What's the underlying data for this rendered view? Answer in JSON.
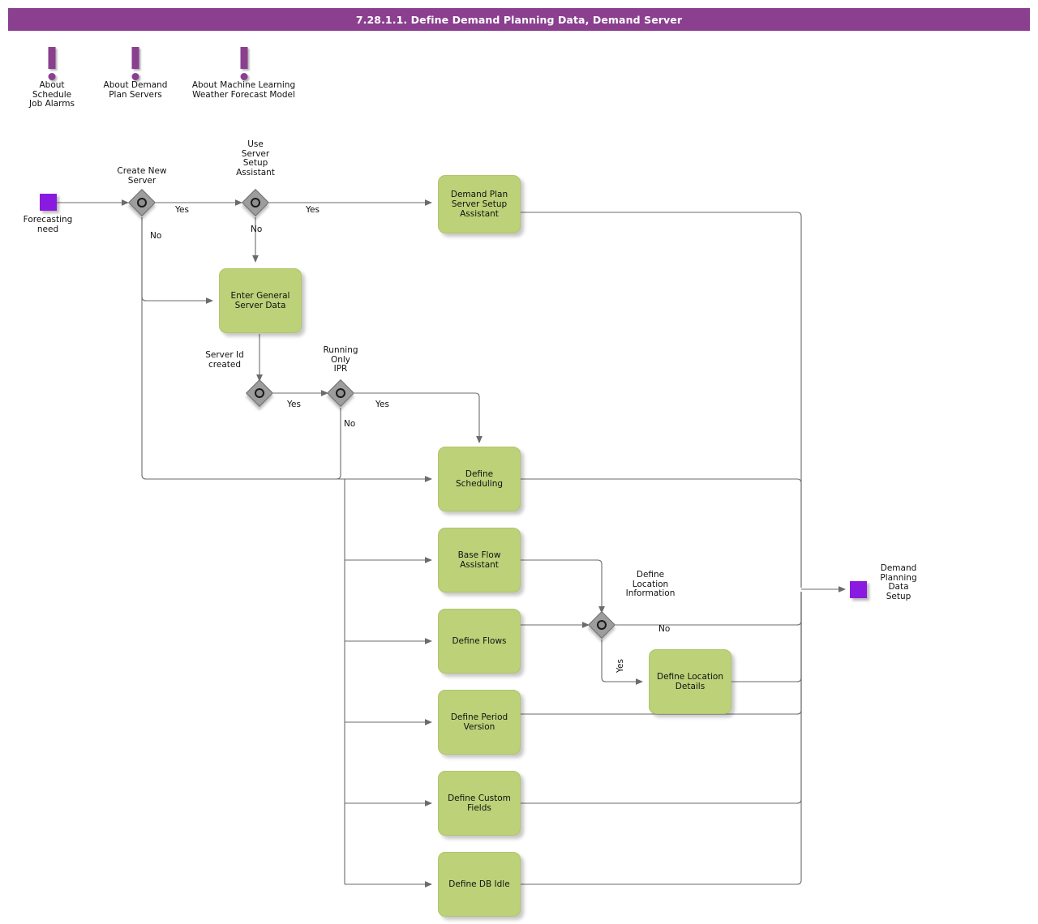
{
  "header": {
    "title": "7.28.1.1. Define Demand Planning Data, Demand Server",
    "bar_color": "#8a3f8f",
    "title_color": "#ffffff"
  },
  "palette": {
    "task_fill": "#bcd178",
    "event_fill": "#8a1ae0",
    "gateway_fill": "#9d9d9d",
    "connector": "#6b6b6b",
    "text": "#111111"
  },
  "annotations": [
    {
      "id": "note-schedule-job-alarms",
      "icon": "exclamation-icon",
      "label": "About\nSchedule\nJob Alarms"
    },
    {
      "id": "note-demand-plan-servers",
      "icon": "exclamation-icon",
      "label": "About Demand\nPlan Servers"
    },
    {
      "id": "note-ml-weather-forecast",
      "icon": "exclamation-icon",
      "label": "About Machine Learning\nWeather Forecast Model"
    }
  ],
  "events": [
    {
      "id": "start-forecasting-need",
      "type": "start",
      "label": "Forecasting\nneed"
    },
    {
      "id": "end-demand-planning-data-setup",
      "type": "end",
      "label": "Demand\nPlanning\nData\nSetup"
    }
  ],
  "gateways": [
    {
      "id": "gw-create-new-server",
      "label": "Create New\nServer",
      "type": "inclusive"
    },
    {
      "id": "gw-use-server-setup-assistant",
      "label": "Use\nServer\nSetup\nAssistant",
      "type": "inclusive"
    },
    {
      "id": "gw-server-id-created",
      "label": "Server Id\ncreated",
      "type": "inclusive"
    },
    {
      "id": "gw-running-only-ipr",
      "label": "Running\nOnly\nIPR",
      "type": "inclusive"
    },
    {
      "id": "gw-define-location-information",
      "label": "Define\nLocation\nInformation",
      "type": "inclusive"
    }
  ],
  "tasks": [
    {
      "id": "task-demand-plan-server-setup-assistant",
      "label": "Demand Plan\nServer Setup\nAssistant"
    },
    {
      "id": "task-enter-general-server-data",
      "label": "Enter General\nServer Data"
    },
    {
      "id": "task-define-scheduling",
      "label": "Define\nScheduling"
    },
    {
      "id": "task-base-flow-assistant",
      "label": "Base Flow\nAssistant"
    },
    {
      "id": "task-define-flows",
      "label": "Define Flows"
    },
    {
      "id": "task-define-period-version",
      "label": "Define Period\nVersion"
    },
    {
      "id": "task-define-custom-fields",
      "label": "Define Custom\nFields"
    },
    {
      "id": "task-define-db-idle",
      "label": "Define DB Idle"
    },
    {
      "id": "task-define-location-details",
      "label": "Define Location\nDetails"
    }
  ],
  "flow_labels": {
    "create_new_server_yes": "Yes",
    "create_new_server_no": "No",
    "use_assistant_yes": "Yes",
    "use_assistant_no": "No",
    "server_id_created_yes": "Yes",
    "running_only_ipr_yes": "Yes",
    "running_only_ipr_no": "No",
    "location_info_no": "No",
    "location_info_yes": "Yes"
  }
}
